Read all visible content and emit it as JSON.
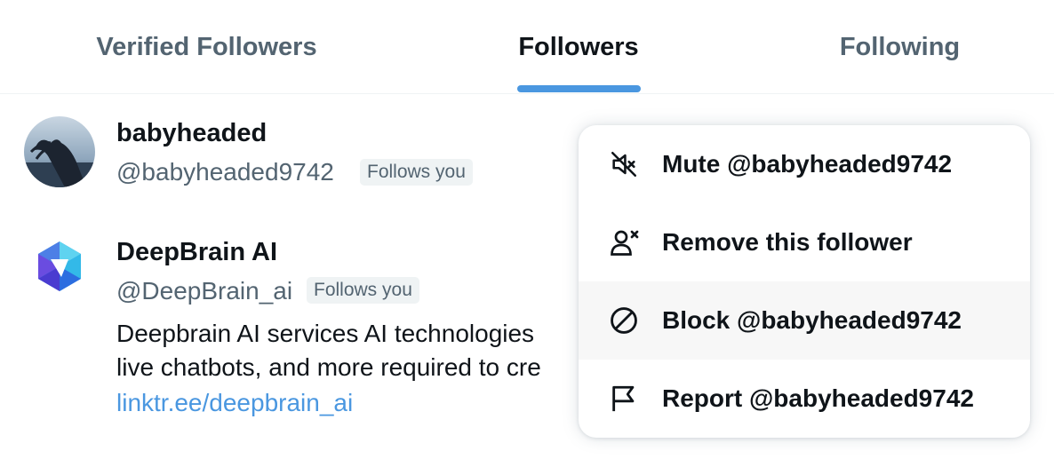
{
  "tabs": [
    {
      "label": "Verified Followers",
      "active": false
    },
    {
      "label": "Followers",
      "active": true
    },
    {
      "label": "Following",
      "active": false
    }
  ],
  "users": [
    {
      "name": "babyheaded",
      "handle": "@babyheaded9742",
      "badge": "Follows you"
    },
    {
      "name": "DeepBrain AI",
      "handle": "@DeepBrain_ai",
      "badge": "Follows you",
      "bio_line1": "Deepbrain AI services AI technologies",
      "bio_line2": "live chatbots, and more required to cre",
      "bio_link": "linktr.ee/deepbrain_ai"
    }
  ],
  "menu": {
    "items": [
      {
        "label": "Mute @babyheaded9742",
        "icon": "mute-icon"
      },
      {
        "label": "Remove this follower",
        "icon": "remove-user-icon"
      },
      {
        "label": "Block @babyheaded9742",
        "icon": "block-icon",
        "hovered": true
      },
      {
        "label": "Report @babyheaded9742",
        "icon": "flag-icon"
      }
    ]
  },
  "colors": {
    "accent": "#4a97e0",
    "text_primary": "#0f1419",
    "text_secondary": "#536471",
    "badge_bg": "#eff3f4",
    "hover_bg": "#f7f7f7"
  }
}
